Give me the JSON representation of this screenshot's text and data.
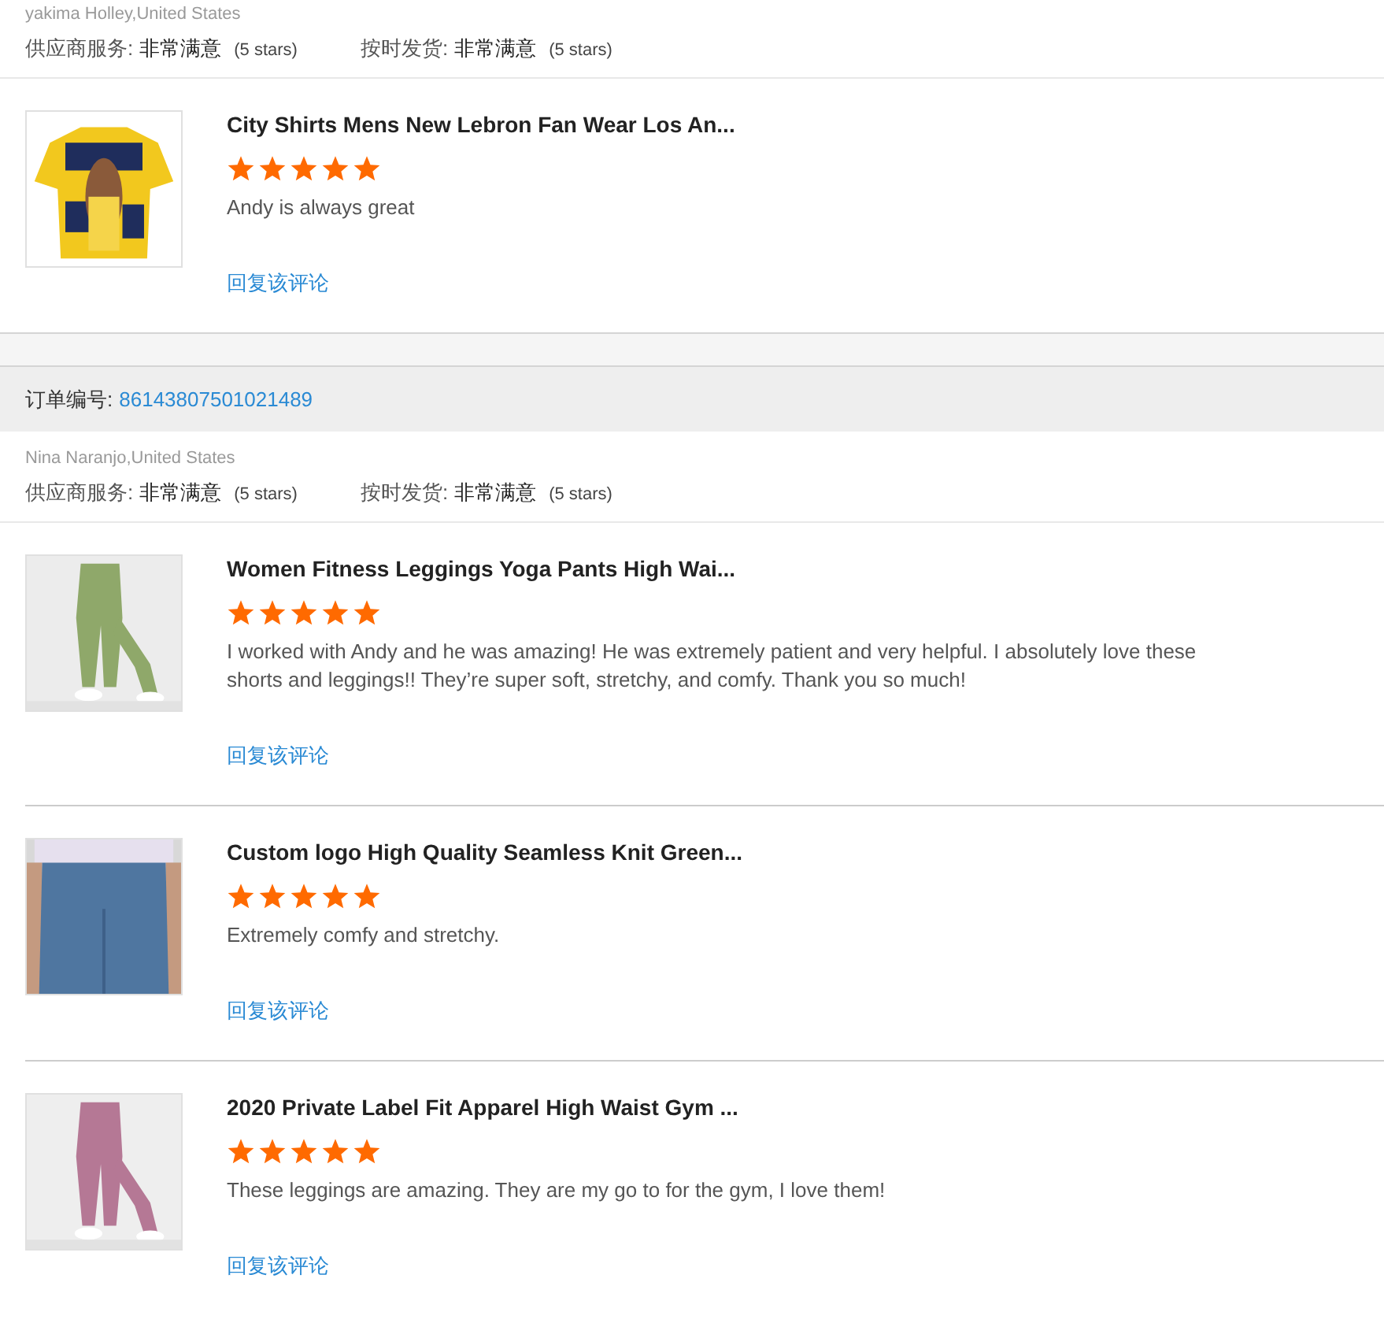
{
  "orders": [
    {
      "reviewer": "yakima Holley,United States",
      "ratings": [
        {
          "label": "供应商服务:",
          "value": "非常满意",
          "note": "(5 stars)"
        },
        {
          "label": "按时发货:",
          "value": "非常满意",
          "note": "(5 stars)"
        }
      ],
      "items": [
        {
          "title": "City Shirts Mens New Lebron Fan Wear Los An...",
          "stars": 5,
          "comment": "Andy is always great",
          "reply": "回复该评论"
        }
      ]
    },
    {
      "order_label": "订单编号:",
      "order_number": "86143807501021489",
      "reviewer": "Nina Naranjo,United States",
      "ratings": [
        {
          "label": "供应商服务:",
          "value": "非常满意",
          "note": "(5 stars)"
        },
        {
          "label": "按时发货:",
          "value": "非常满意",
          "note": "(5 stars)"
        }
      ],
      "items": [
        {
          "title": "Women Fitness Leggings Yoga Pants High Wai...",
          "stars": 5,
          "comment": "I worked with Andy and he was amazing! He was extremely patient and very helpful. I absolutely love these shorts and leggings!! They’re super soft, stretchy, and comfy. Thank you so much!",
          "reply": "回复该评论"
        },
        {
          "title": "Custom logo High Quality Seamless Knit Green...",
          "stars": 5,
          "comment": "Extremely comfy and stretchy.",
          "reply": "回复该评论"
        },
        {
          "title": "2020 Private Label Fit Apparel High Waist Gym ...",
          "stars": 5,
          "comment": "These leggings are amazing. They are my go to for the gym, I love them!",
          "reply": "回复该评论"
        }
      ]
    }
  ]
}
